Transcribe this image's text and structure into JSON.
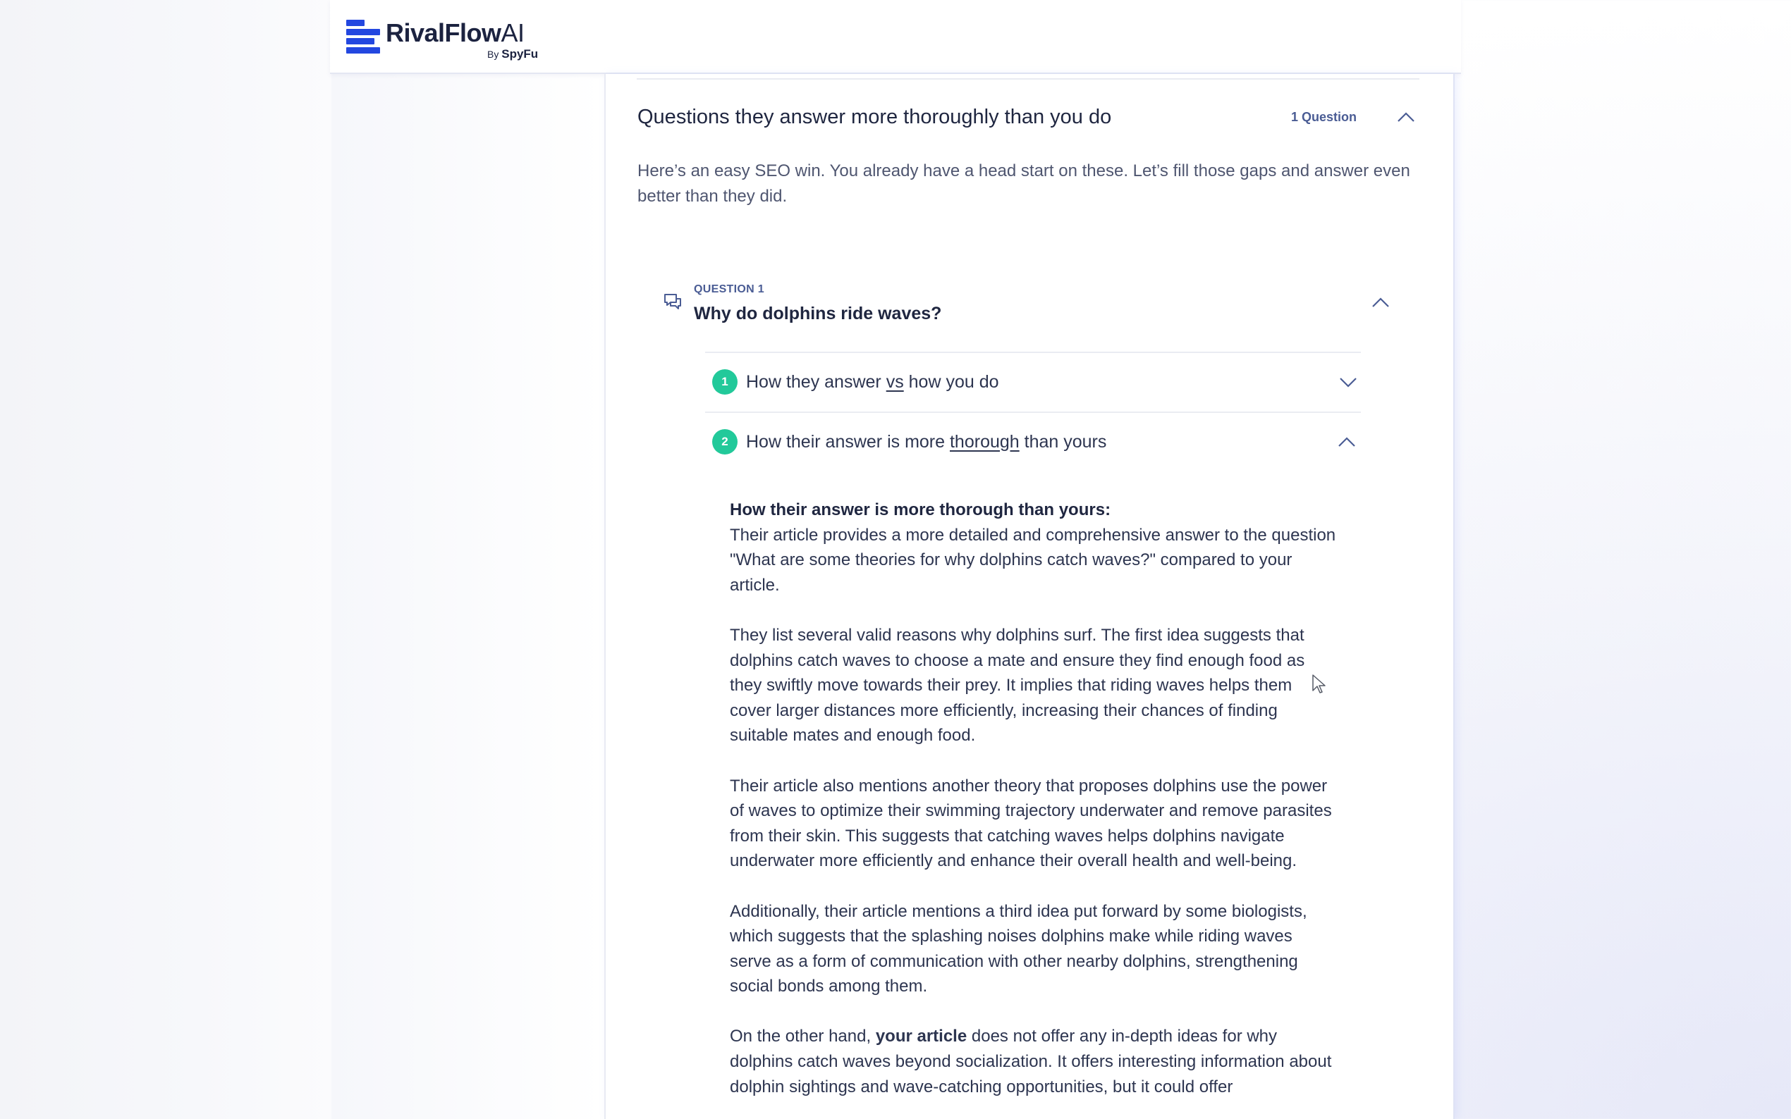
{
  "app": {
    "brand": "RivalFlow",
    "brand_suffix": "AI",
    "byline_prefix": "By",
    "byline_brand": "SpyFu"
  },
  "section": {
    "title": "Questions they answer more thoroughly than you do",
    "count": "1 Question",
    "intro": "Here’s an easy SEO win. You already have a head start on these. Let’s fill those gaps and answer even better than they did."
  },
  "question": {
    "label": "QUESTION 1",
    "text": "Why do dolphins ride waves?",
    "subsections": [
      {
        "number": "1",
        "pre": "How they answer ",
        "emph": "vs",
        "post": " how you do",
        "expanded": false
      },
      {
        "number": "2",
        "pre": "How their answer is more ",
        "emph": "thorough",
        "post": " than yours",
        "expanded": true
      }
    ],
    "answer": {
      "heading": "How their answer is more thorough than yours:",
      "p1": "Their article provides a more detailed and comprehensive answer to the question \"What are some theories for why dolphins catch waves?\" compared to your article.",
      "p2": "They list several valid reasons why dolphins surf. The first idea suggests that dolphins catch waves to choose a mate and ensure they find enough food as they swiftly move towards their prey. It implies that riding waves helps them cover larger distances more efficiently, increasing their chances of finding suitable mates and enough food.",
      "p3": "Their article also mentions another theory that proposes dolphins use the power of waves to optimize their swimming trajectory underwater and remove parasites from their skin. This suggests that catching waves helps dolphins navigate underwater more efficiently and enhance their overall health and well-being.",
      "p4": "Additionally, their article mentions a third idea put forward by some biologists, which suggests that the splashing noises dolphins make while riding waves serve as a form of communication with other nearby dolphins, strengthening social bonds among them.",
      "p5_pre": "On the other hand, ",
      "p5_bold": "your article",
      "p5_post": " does not offer any in-depth ideas for why dolphins catch waves beyond socialization. It offers interesting information about dolphin sightings and wave-catching opportunities, but it could offer"
    }
  },
  "colors": {
    "brand_blue": "#2347e0",
    "badge_green": "#22c99a",
    "label_blue": "#4a5c94"
  },
  "icons": [
    "chat-bubbles-icon",
    "chevron-up-icon",
    "chevron-down-icon",
    "mouse-cursor-icon"
  ]
}
